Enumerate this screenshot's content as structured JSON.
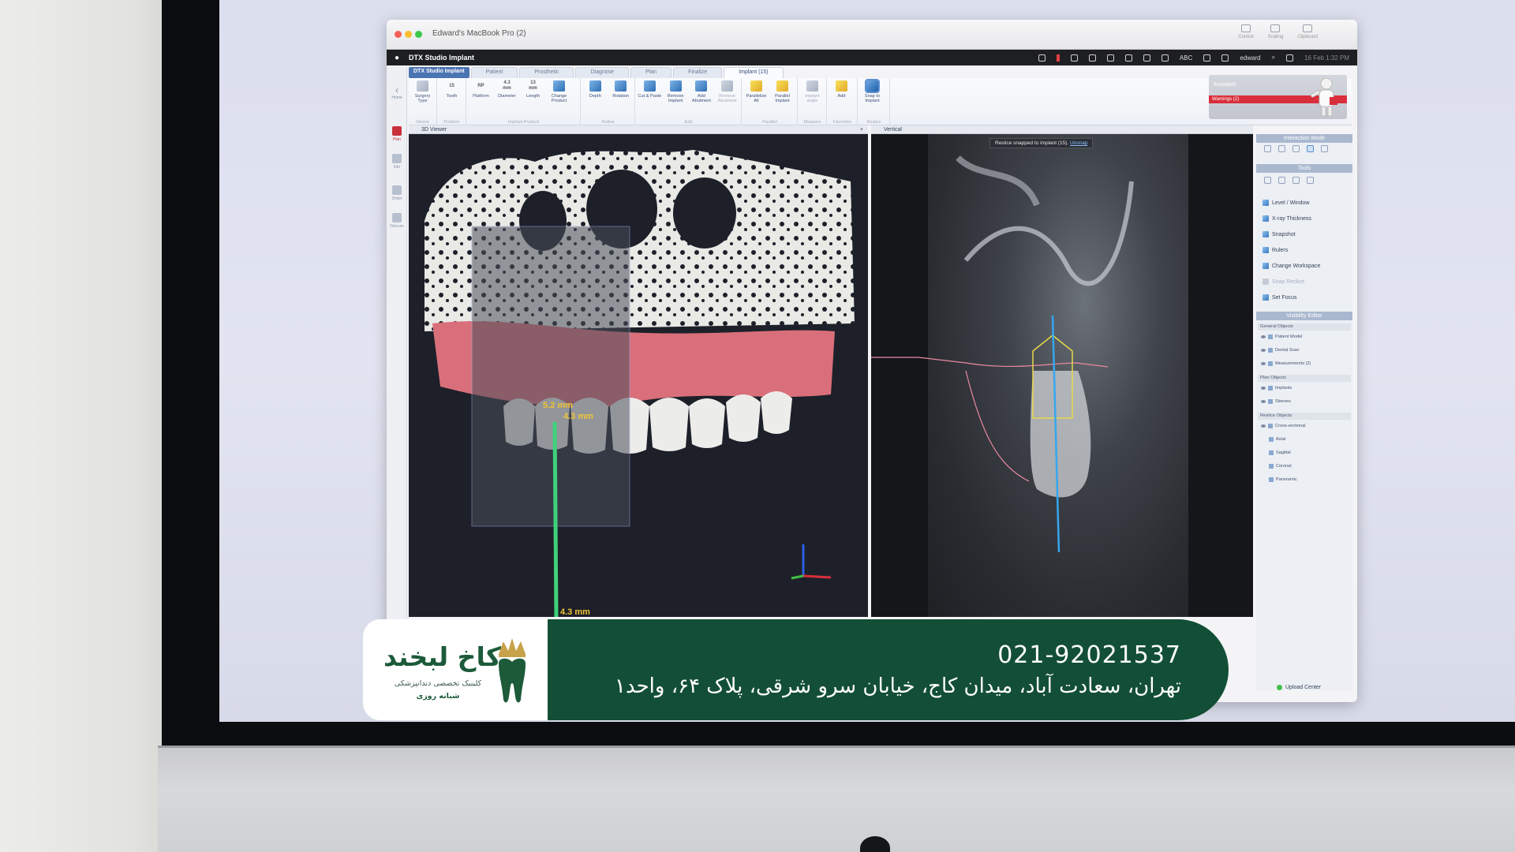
{
  "window": {
    "title": "Edward's MacBook Pro (2)",
    "remote_tools": [
      "Control",
      "Scaling",
      "Clipboard"
    ]
  },
  "menubar": {
    "app_name": "DTX Studio Implant",
    "user": "edward",
    "input_source": "ABC",
    "datetime": "16 Feb 1:32 PM"
  },
  "ribbon": {
    "app_dropdown": "DTX Studio Implant",
    "tabs": [
      "Patient",
      "Prosthetic",
      "Diagnose",
      "Plan",
      "Finalize",
      "Implant (15)"
    ],
    "active_tab": "Implant (15)",
    "sleeve": {
      "label": "Sleeve",
      "buttons": [
        "Surgery Type"
      ]
    },
    "position": {
      "label": "Position",
      "tooth_value": "15",
      "buttons": [
        "Tooth"
      ]
    },
    "implant_product": {
      "label": "Implant Product",
      "platform_value": "RP",
      "diameter_value": "4.3 mm",
      "length_value": "13 mm",
      "buttons": [
        "Platform",
        "Diameter",
        "Length",
        "Change Product"
      ]
    },
    "refine": {
      "label": "Refine",
      "buttons": [
        "Depth",
        "Rotation"
      ]
    },
    "edit": {
      "label": "Edit",
      "buttons": [
        "Cut & Paste",
        "Remove Implant",
        "Add Abutment",
        "Remove Abutment"
      ]
    },
    "parallel": {
      "label": "Parallel",
      "buttons": [
        "Parallelize All",
        "Parallel Implant"
      ]
    },
    "measure": {
      "label": "Measure",
      "buttons": [
        "Implant angle"
      ]
    },
    "favorites": {
      "label": "Favorites",
      "buttons": [
        "Add"
      ]
    },
    "reslice": {
      "label": "Reslice",
      "buttons": [
        "Snap to Implant"
      ]
    }
  },
  "assistant": {
    "label": "Assistant",
    "warnings": "Warnings (2)"
  },
  "leftnav": [
    "Home",
    "Plan",
    "Info",
    "Order",
    "Discuss"
  ],
  "viewer3d": {
    "title": "3D Viewer",
    "measure_1": "5.2 mm",
    "measure_2": "4.3 mm",
    "measure_3": "4.3 mm"
  },
  "vertical_viewer": {
    "title": "Vertical",
    "snap_note": "Reslice snapped to implant (15).",
    "unsnap": "Unsnap"
  },
  "right_panel": {
    "interaction_mode": "Interaction Mode",
    "tools_title": "Tools",
    "tools": [
      "Level / Window",
      "X-ray Thickness",
      "Snapshot",
      "Rulers",
      "Change Workspace",
      "Snap Reslice",
      "Set Focus"
    ],
    "visibility_editor": "Visibility Editor",
    "general_objects": "General Objects",
    "general_items": [
      "Patient Model",
      "Dental Scan",
      "Measurements (2)"
    ],
    "plan_objects": "Plan Objects",
    "plan_items": [
      "Implants",
      "Sleeves"
    ],
    "reslice_objects": "Reslice Objects",
    "reslice_items": [
      "Cross-sectional",
      "Axial",
      "Sagittal",
      "Coronal",
      "Panoramic"
    ],
    "upload_center": "Upload Center"
  },
  "overlay": {
    "logo_name": "کاخ لبخند",
    "logo_subtitle": "کلینیک تخصصی دندانپزشکی",
    "logo_subtitle2": "شبانه روزی",
    "phone": "021-92021537",
    "address": "تهران، سعادت آباد، میدان کاج، خیابان سرو شرقی، پلاک ۶۴، واحد۱",
    "brand_green": "#134f36"
  }
}
